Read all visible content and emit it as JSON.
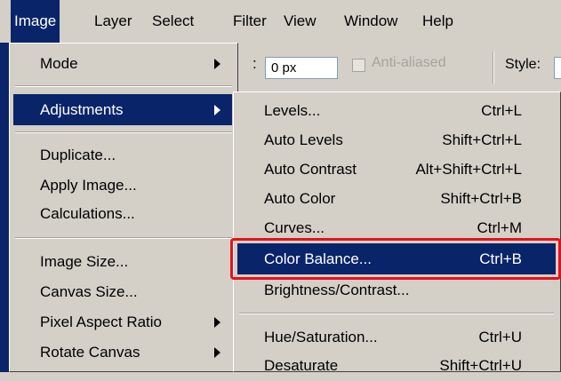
{
  "menubar": {
    "items": [
      {
        "label": "Image",
        "active": true
      },
      {
        "label": "Layer"
      },
      {
        "label": "Select"
      },
      {
        "label": "Filter"
      },
      {
        "label": "View"
      },
      {
        "label": "Window"
      },
      {
        "label": "Help"
      }
    ]
  },
  "toolbar": {
    "colon": ":",
    "feather_value": "0 px",
    "anti_aliased_label": "Anti-aliased",
    "style_label": "Style:"
  },
  "image_menu": {
    "items": [
      {
        "label": "Mode",
        "submenu": true
      },
      {
        "label": "Adjustments",
        "submenu": true,
        "selected": true
      },
      {
        "label": "Duplicate..."
      },
      {
        "label": "Apply Image..."
      },
      {
        "label": "Calculations..."
      },
      {
        "label": "Image Size..."
      },
      {
        "label": "Canvas Size..."
      },
      {
        "label": "Pixel Aspect Ratio",
        "submenu": true
      },
      {
        "label": "Rotate Canvas",
        "submenu": true
      }
    ]
  },
  "adjustments_menu": {
    "items": [
      {
        "label": "Levels...",
        "shortcut": "Ctrl+L"
      },
      {
        "label": "Auto Levels",
        "shortcut": "Shift+Ctrl+L"
      },
      {
        "label": "Auto Contrast",
        "shortcut": "Alt+Shift+Ctrl+L"
      },
      {
        "label": "Auto Color",
        "shortcut": "Shift+Ctrl+B"
      },
      {
        "label": "Curves...",
        "shortcut": "Ctrl+M"
      },
      {
        "label": "Color Balance...",
        "shortcut": "Ctrl+B",
        "selected": true
      },
      {
        "label": "Brightness/Contrast...",
        "shortcut": ""
      },
      {
        "label": "Hue/Saturation...",
        "shortcut": "Ctrl+U"
      },
      {
        "label": "Desaturate",
        "shortcut": "Shift+Ctrl+U"
      }
    ]
  },
  "colors": {
    "menu_bg": "#d4d0c8",
    "selection": "#0a246a",
    "highlight_box": "#e8101a"
  }
}
